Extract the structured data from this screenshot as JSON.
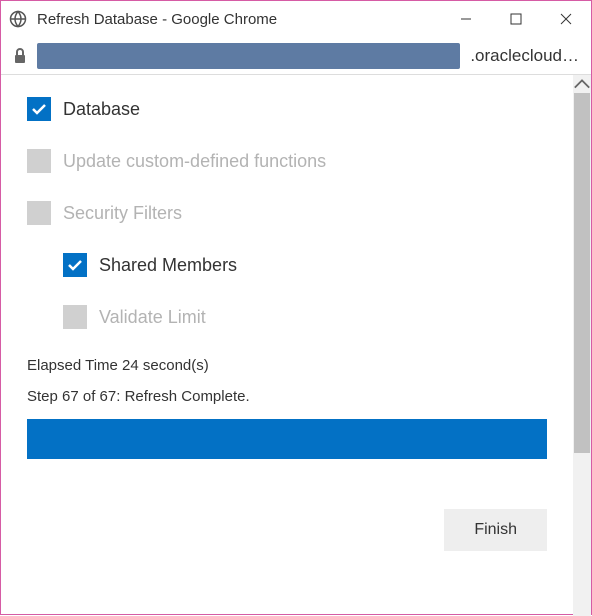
{
  "window": {
    "title": "Refresh Database - Google Chrome",
    "url_visible_trail": ".oraclecloud…"
  },
  "options": {
    "database": {
      "label": "Database",
      "checked": true,
      "enabled": true
    },
    "update_functions": {
      "label": "Update custom-defined functions",
      "checked": false,
      "enabled": false
    },
    "security_filters": {
      "label": "Security Filters",
      "checked": false,
      "enabled": false
    },
    "shared_members": {
      "label": "Shared Members",
      "checked": true,
      "enabled": true
    },
    "validate_limit": {
      "label": "Validate Limit",
      "checked": false,
      "enabled": false
    }
  },
  "status": {
    "elapsed": "Elapsed Time 24 second(s)",
    "step": "Step 67 of 67: Refresh Complete."
  },
  "progress": {
    "percent": 100,
    "color": "#0371c5"
  },
  "buttons": {
    "finish": "Finish"
  }
}
